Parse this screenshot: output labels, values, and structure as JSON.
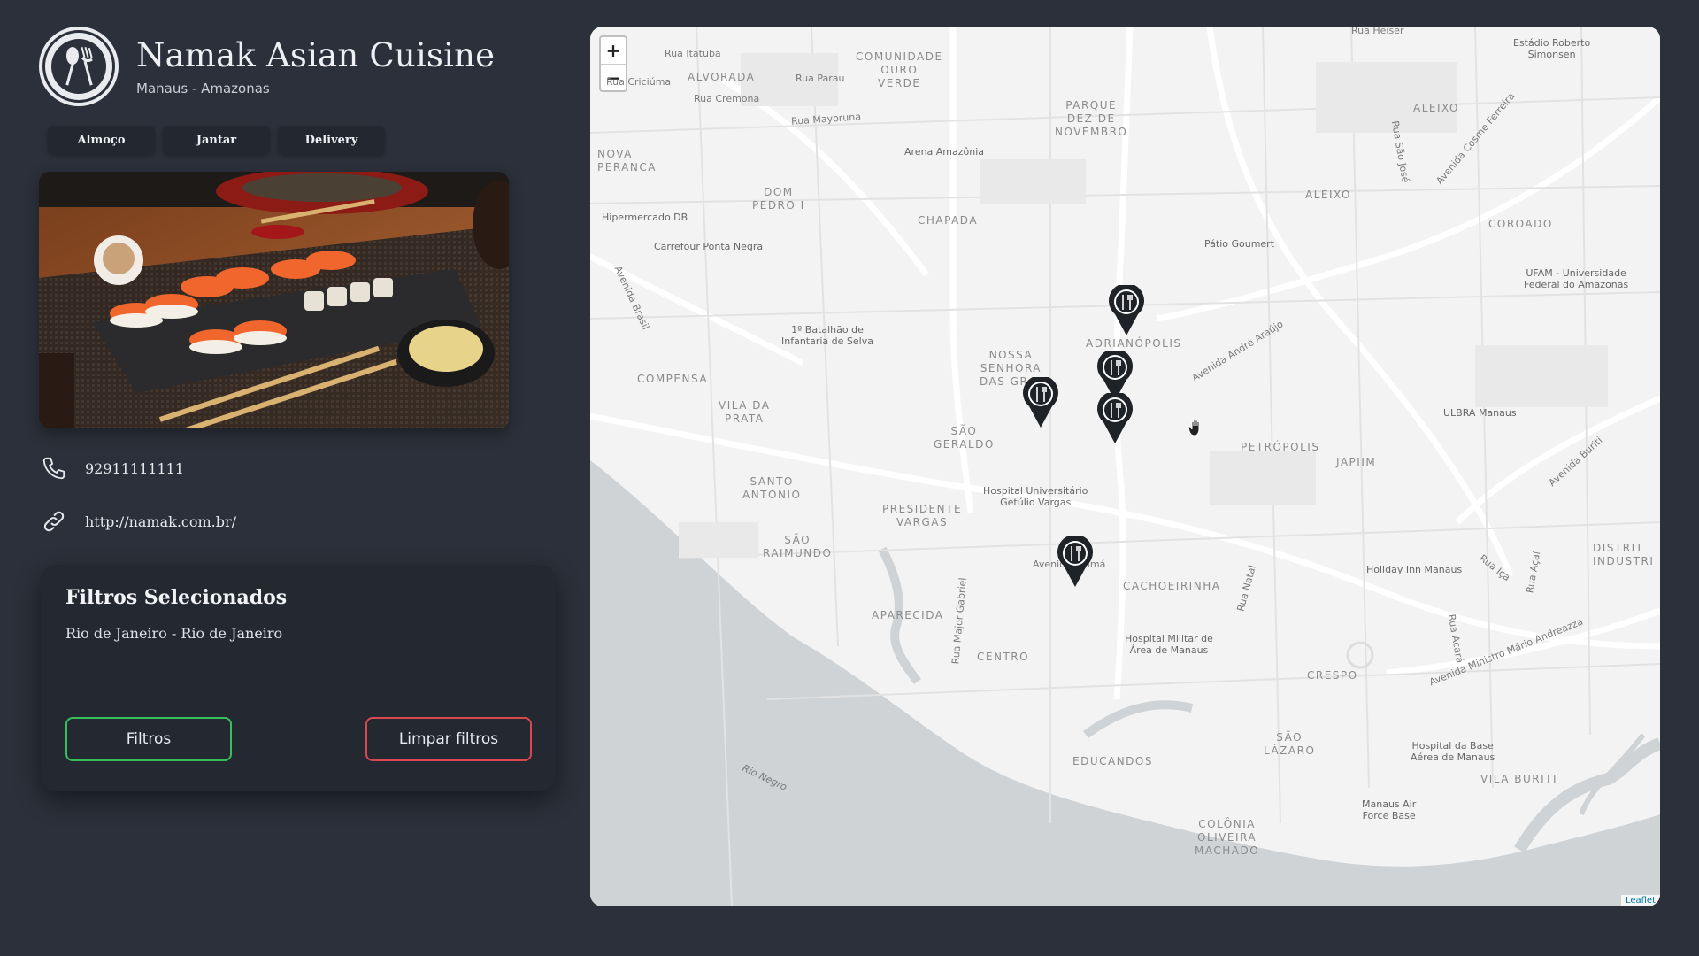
{
  "brand": {
    "title": "Namak Asian Cuisine",
    "location": "Manaus - Amazonas",
    "logo_icon": "fork-spoon-icon"
  },
  "tags": [
    "Almoço",
    "Jantar",
    "Delivery"
  ],
  "contact": {
    "phone": "92911111111",
    "website": "http://namak.com.br/"
  },
  "filters": {
    "title": "Filtros Selecionados",
    "value": "Rio de Janeiro - Rio de Janeiro",
    "apply_label": "Filtros",
    "clear_label": "Limpar filtros"
  },
  "map": {
    "zoom_in": "+",
    "zoom_out": "−",
    "attribution": "Leaflet",
    "districts": {
      "comunidade": "COMUNIDADE\nOURO\nVERDE",
      "alvorada": "ALVORADA",
      "parque": "PARQUE\nDEZ DE\nNOVEMBRO",
      "aleixo1": "ALEIXO",
      "aleixo2": "ALEIXO",
      "nova": "NOVA\nPERANCA",
      "dom": "DOM\nPEDRO I",
      "chapada": "CHAPADA",
      "coroado": "COROADO",
      "adrianopolis": "ADRIANÓPOLIS",
      "nossa": "NOSSA\nSENHORA\nDAS GR...",
      "compensa": "COMPENSA",
      "vila": "VILA DA\nPRATA",
      "saogeraldo": "SÃO\nGERALDO",
      "petropolis": "PETRÓPOLIS",
      "japiim": "JAPIIM",
      "santo": "SANTO\nANTONIO",
      "presidente": "PRESIDENTE\nVARGAS",
      "saoraimundo": "SÃO\nRAIMUNDO",
      "cachoeirinha": "CACHOEIRINHA",
      "aparecida": "APARECIDA",
      "centro": "CENTRO",
      "crespo": "CRESPO",
      "saolazaro": "SÃO\nLÁZARO",
      "educandos": "EDUCANDOS",
      "colonia": "COLÔNIA\nOLIVEIRA\nMACHADO",
      "vilaburiti": "VILA BURITI",
      "distrito": "DISTRIT\nINDUSTRI"
    },
    "streets": {
      "itatuba": "Rua Itatuba",
      "criciuma": "Rua Criciúma",
      "cremona": "Rua Cremona",
      "parau": "Rua Parau",
      "mayoruna": "Rua Mayoruna",
      "brasil": "Avenida Brasil",
      "andre": "Avenida André Araújo",
      "buriti": "Avenida Buriti",
      "saojose": "Rua São José",
      "cosme": "Avenida Cosme Ferreira",
      "maiorgabriel": "Rua Major Gabriel",
      "natal": "Rua Natal",
      "ica": "Rua Içá",
      "acai": "Rua Açaí",
      "acara": "Rua Acará",
      "andreazza": "Avenida Ministro Mário Andreazza",
      "rionegro": "Rio Negro",
      "avenidaumas": "Avenida... umá",
      "heiser": "Rua Heiser"
    },
    "pois": {
      "arena": "Arena Amazônia",
      "hipermercado": "Hipermercado DB",
      "carrefour": "Carrefour Ponta Negra",
      "batalhao": "1º Batalhão de\nInfantaria de Selva",
      "patio": "Pátio Goumert",
      "ufam": "UFAM - Universidade\nFederal do Amazonas",
      "estadio": "Estádio Roberto\nSimonsen",
      "ulbra": "ULBRA Manaus",
      "hospital": "Hospital Universitário\nGetúlio Vargas",
      "holiday": "Holiday Inn Manaus",
      "hospitalmilitar": "Hospital Militar de\nÁrea de Manaus",
      "hospitalbase": "Hospital da Base\nAérea de Manaus",
      "airforce": "Manaus Air\nForce Base"
    },
    "marker_icon": "restaurant-pin-icon"
  }
}
